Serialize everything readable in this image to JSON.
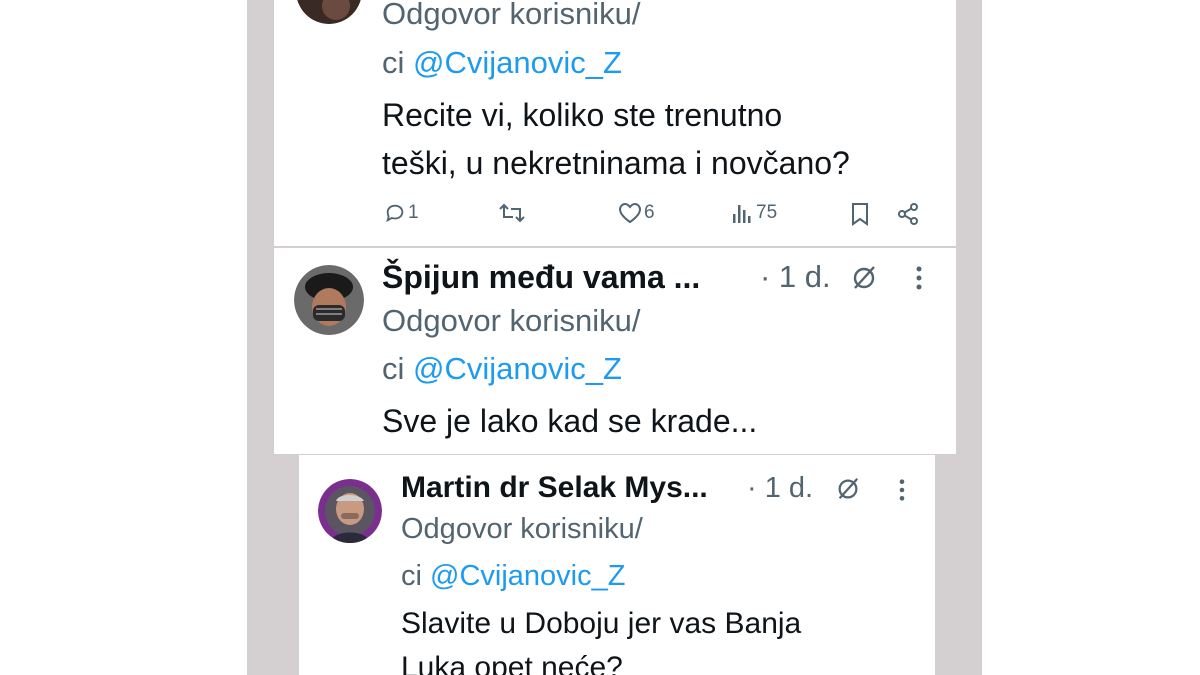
{
  "colors": {
    "accent": "#1d9bf0",
    "text": "#0f1419",
    "muted": "#536471",
    "frame": "#d4d0d2"
  },
  "tweets": [
    {
      "reply_label": "Odgovor korisniku/",
      "reply_prefix": "ci ",
      "mention": "@Cvijanovic_Z",
      "body_line1": "Recite vi, koliko ste trenutno",
      "body_line2": "teški, u nekretninama i novčano?",
      "actions": {
        "reply_icon": "reply-icon",
        "reply_count": "1",
        "retweet_icon": "retweet-icon",
        "like_icon": "heart-icon",
        "like_count": "6",
        "views_icon": "views-icon",
        "views_count": "75",
        "bookmark_icon": "bookmark-icon",
        "share_icon": "share-icon"
      }
    },
    {
      "name": "Špijun među vama ...",
      "time": "· 1 d.",
      "reply_label": "Odgovor korisniku/",
      "reply_prefix": "ci ",
      "mention": "@Cvijanovic_Z",
      "body_line1": "Sve je lako kad se krade..."
    },
    {
      "name": "Martin dr Selak Mys...",
      "time": "· 1 d.",
      "reply_label": "Odgovor korisniku/",
      "reply_prefix": "ci ",
      "mention": "@Cvijanovic_Z",
      "body_line1": "Slavite u Doboju jer vas Banja",
      "body_line2": "Luka opet neće?"
    }
  ]
}
